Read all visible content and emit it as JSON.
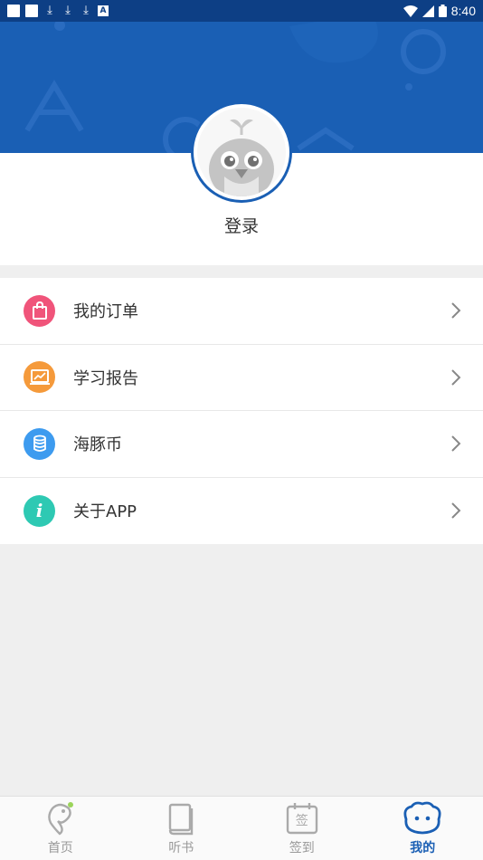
{
  "status_bar": {
    "time": "8:40",
    "mini_icon_letter": "A"
  },
  "profile": {
    "login_label": "登录"
  },
  "menu": {
    "items": [
      {
        "label": "我的订单",
        "icon": "shopping-bag-icon",
        "color": "#f0547a"
      },
      {
        "label": "学习报告",
        "icon": "report-chart-icon",
        "color": "#f59a3b"
      },
      {
        "label": "海豚币",
        "icon": "coin-stack-icon",
        "color": "#3d9bef"
      },
      {
        "label": "关于APP",
        "icon": "info-icon",
        "color": "#2ec9b3",
        "glyph": "i"
      }
    ]
  },
  "tabbar": {
    "tabs": [
      {
        "label": "首页",
        "icon": "dolphin-icon",
        "active": false
      },
      {
        "label": "听书",
        "icon": "book-icon",
        "active": false
      },
      {
        "label": "签到",
        "icon": "calendar-sign-icon",
        "active": false,
        "glyph": "签"
      },
      {
        "label": "我的",
        "icon": "face-icon",
        "active": true
      }
    ]
  },
  "colors": {
    "primary": "#1a5fb4",
    "status_bar": "#0d3f85"
  }
}
